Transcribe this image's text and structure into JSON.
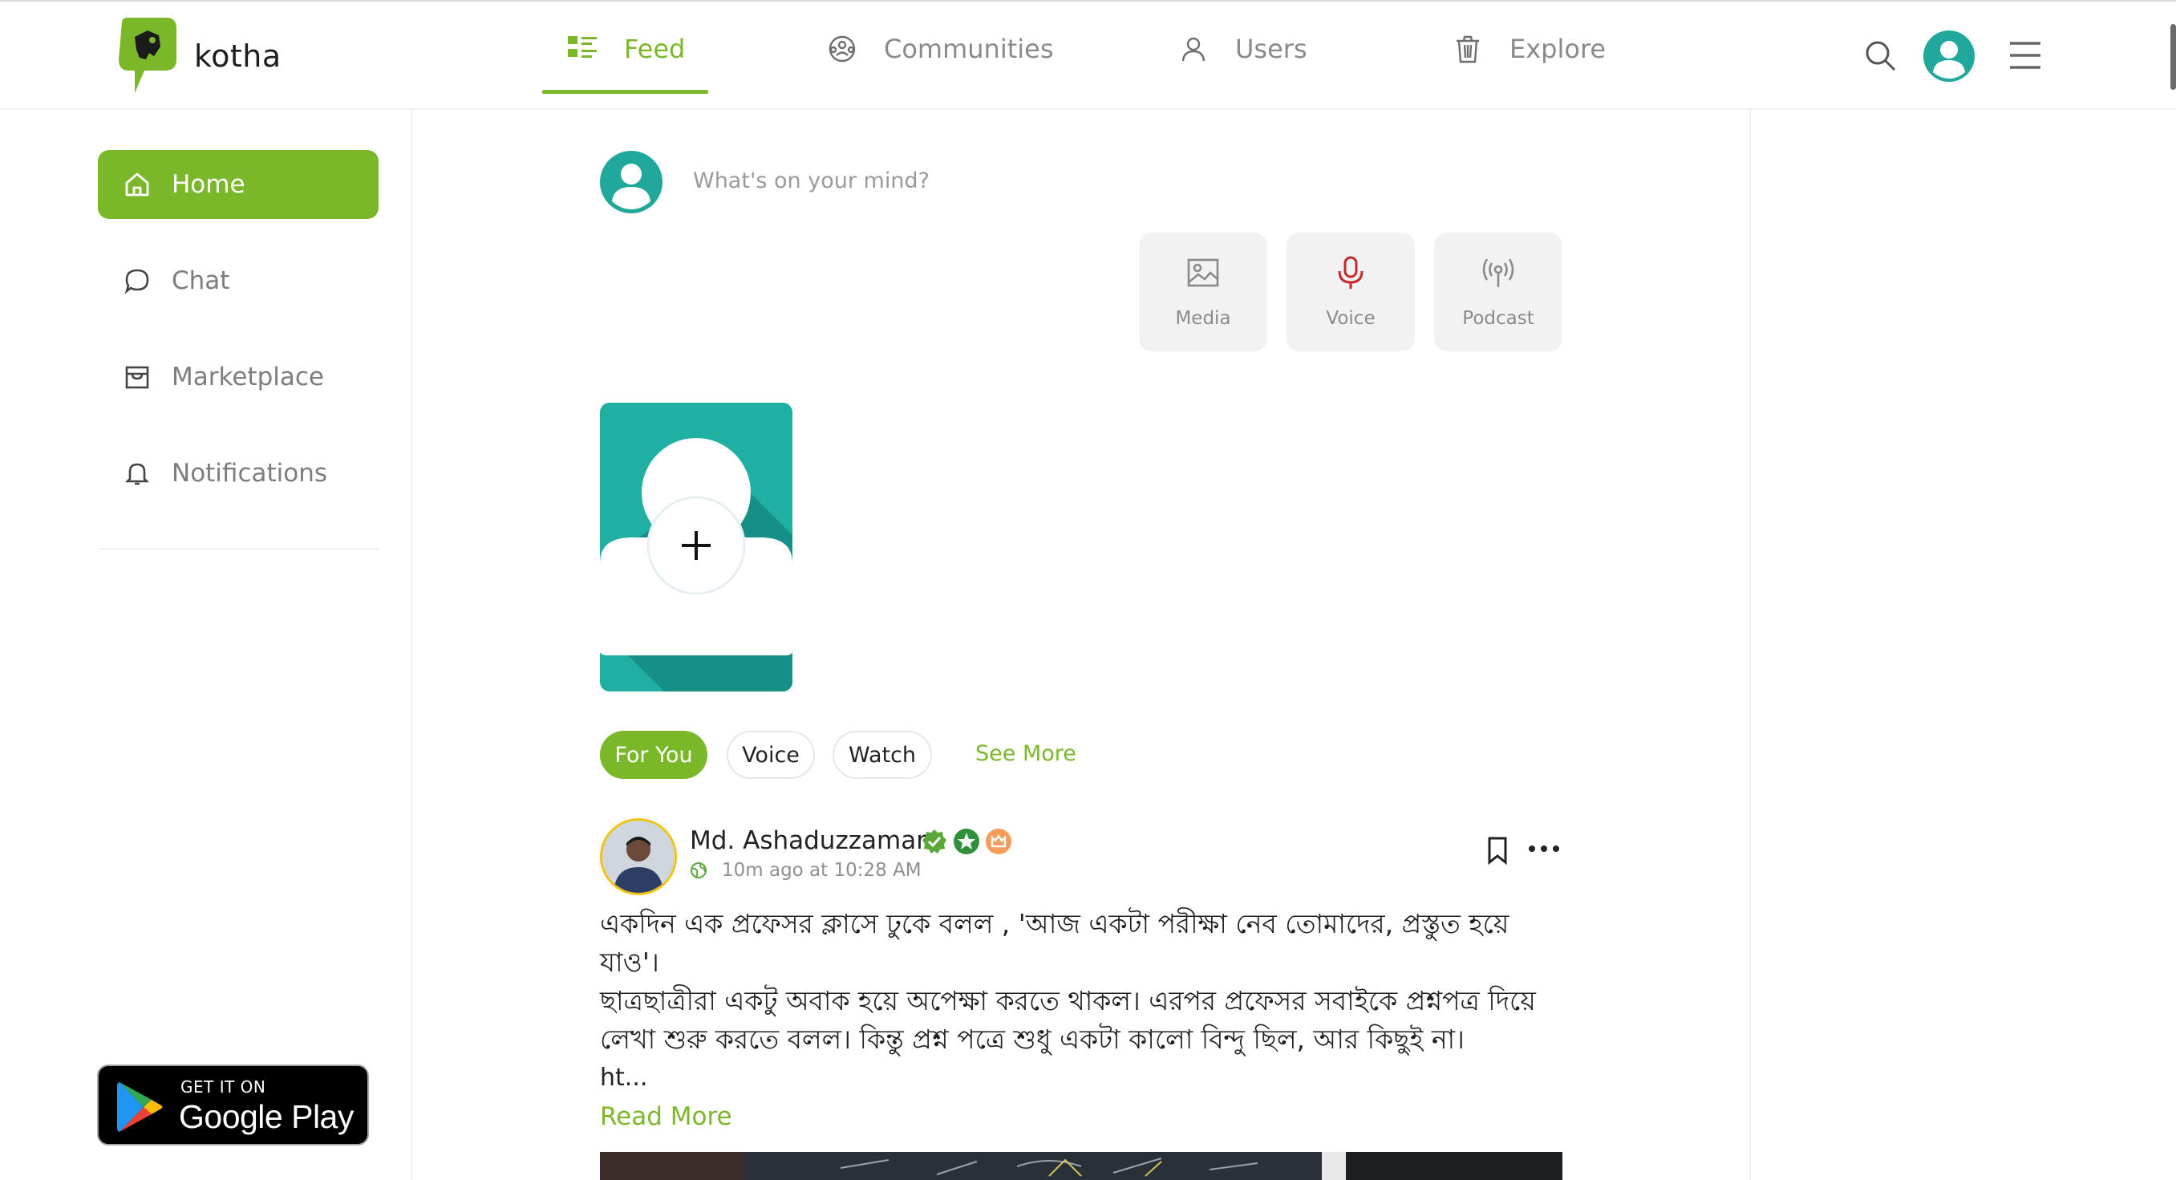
{
  "app": {
    "name": "kotha",
    "brand_color": "#7ab82a"
  },
  "nav": {
    "tabs": [
      {
        "label": "Feed",
        "icon": "feed-icon",
        "active": true
      },
      {
        "label": "Communities",
        "icon": "communities-icon",
        "active": false
      },
      {
        "label": "Users",
        "icon": "user-icon",
        "active": false
      },
      {
        "label": "Explore",
        "icon": "trash-bin-icon",
        "active": false
      }
    ],
    "actions": [
      "search-icon",
      "profile-avatar",
      "hamburger-menu-icon"
    ]
  },
  "sidebar": {
    "items": [
      {
        "label": "Home",
        "icon": "home-icon",
        "active": true
      },
      {
        "label": "Chat",
        "icon": "chat-bubble-icon",
        "active": false
      },
      {
        "label": "Marketplace",
        "icon": "store-icon",
        "active": false
      },
      {
        "label": "Notifications",
        "icon": "bell-icon",
        "active": false
      }
    ],
    "store_badge": {
      "small": "GET IT ON",
      "big": "Google Play"
    }
  },
  "composer": {
    "placeholder": "What's on your mind?",
    "buttons": [
      {
        "label": "Media",
        "icon": "image-icon"
      },
      {
        "label": "Voice",
        "icon": "microphone-icon",
        "color": "#c62828"
      },
      {
        "label": "Podcast",
        "icon": "broadcast-icon"
      }
    ]
  },
  "story": {
    "add_symbol": "+"
  },
  "filters": {
    "chips": [
      "For You",
      "Voice",
      "Watch"
    ],
    "active": "For You",
    "see_more": "See More"
  },
  "post": {
    "author": "Md. Ashaduzzaman",
    "badges": [
      "verified-badge-icon",
      "star-badge-icon",
      "crown-badge-icon"
    ],
    "time": "10m ago at 10:28 AM",
    "privacy_icon": "globe-icon",
    "body": "একদিন এক প্রফেসর ক্লাসে ঢুকে বলল , 'আজ একটা পরীক্ষা নেব তোমাদের, প্রস্তুত হয়ে যাও'।\nছাত্রছাত্রীরা একটু অবাক হয়ে অপেক্ষা করতে থাকল। এরপর প্রফেসর সবাইকে প্রশ্নপত্র দিয়ে\nলেখা শুরু করতে বলল। কিন্তু প্রশ্ন পত্রে শুধু একটা কালো বিন্দু ছিল, আর কিছুই না।",
    "truncated": "ht...",
    "read_more": "Read More"
  }
}
